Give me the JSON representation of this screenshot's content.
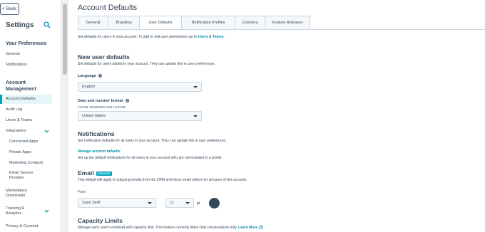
{
  "sidebar": {
    "back_label": "< Back",
    "title": "Settings",
    "sections": [
      {
        "label": "Your Preferences"
      },
      {
        "label": "Account\nManagement"
      }
    ],
    "items": [
      {
        "label": "General"
      },
      {
        "label": "Notifications"
      },
      {
        "label": "Account Defaults"
      },
      {
        "label": "Audit Log"
      },
      {
        "label": "Users & Teams"
      },
      {
        "label": "Integrations"
      },
      {
        "label": "Connected Apps"
      },
      {
        "label": "Private Apps"
      },
      {
        "label": "Marketing Contacts"
      },
      {
        "label": "Email Service Provider"
      },
      {
        "label": "Marketplace Downloads"
      },
      {
        "label": "Tracking & Analytics"
      },
      {
        "label": "Privacy & Consent"
      }
    ]
  },
  "main": {
    "title": "Account Defaults",
    "tabs": [
      {
        "label": "General"
      },
      {
        "label": "Branding"
      },
      {
        "label": "User Defaults"
      },
      {
        "label": "Notification Profiles"
      },
      {
        "label": "Currency"
      },
      {
        "label": "Feature Releases"
      }
    ],
    "intro_text": "Set defaults for users in your account. To add or edit user permissions go to",
    "intro_link": "Users & Teams.",
    "new_user": {
      "heading": "New user defaults",
      "desc": "Set defaults for users added to your account. They can update this in user preferences.",
      "language_label": "Language",
      "language_value": "English",
      "date_label": "Date and number format",
      "date_hint": "Format: 09/26/2024 and 1,234.56",
      "date_value": "United States"
    },
    "notifications": {
      "heading": "Notifications",
      "desc": "Set notification defaults for all users in your account. They can update this in user preferences.",
      "manage_link": "Manage account defaults",
      "manage_desc": "Set up the default notifications for all users in your account who are not included in a profile."
    },
    "email": {
      "heading": "Email",
      "badge": "UPDATED",
      "desc": "This default will apply to outgoing emails from the CRM and Inbox email editors for all users of this account.",
      "font_label": "Font",
      "font_value": "Sans Serif",
      "size_value": "11",
      "size_unit": "pt"
    },
    "capacity": {
      "heading": "Capacity Limits",
      "desc": "Manage each user's workload with capacity limit. This feature currently limits chat conversations only.",
      "learn_more": "Learn More"
    }
  }
}
